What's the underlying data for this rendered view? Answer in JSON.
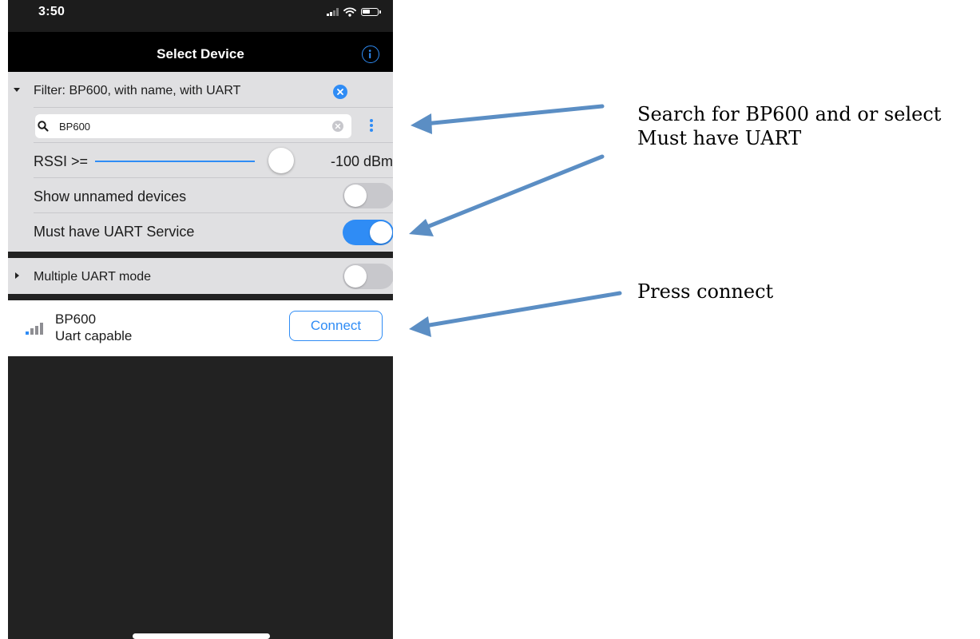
{
  "status_bar": {
    "time": "3:50"
  },
  "nav": {
    "title": "Select Device",
    "info_icon": "info-circle-icon"
  },
  "filter": {
    "header_label": "Filter: BP600, with name, with UART",
    "expanded": true,
    "search": {
      "value": "BP600",
      "placeholder": ""
    },
    "rssi": {
      "label": "RSSI >=",
      "value_text": "-100 dBm",
      "slider_fraction": 1.0
    },
    "show_unnamed": {
      "label": "Show unnamed devices",
      "on": false
    },
    "must_have_uart": {
      "label": "Must have UART Service",
      "on": true
    }
  },
  "multiple_uart": {
    "label": "Multiple UART mode",
    "on": false
  },
  "devices": [
    {
      "name": "BP600",
      "subtitle": "Uart capable",
      "signal_level": 1,
      "action_label": "Connect"
    }
  ],
  "annotations": {
    "search_note_line1": "Search for BP600 and or select",
    "search_note_line2": "Must have UART",
    "connect_note": "Press connect",
    "arrow_color": "#5b8ec4"
  },
  "colors": {
    "accent": "#2f8cf5",
    "panel_bg": "#e0e0e2",
    "dark_bg": "#222222"
  }
}
